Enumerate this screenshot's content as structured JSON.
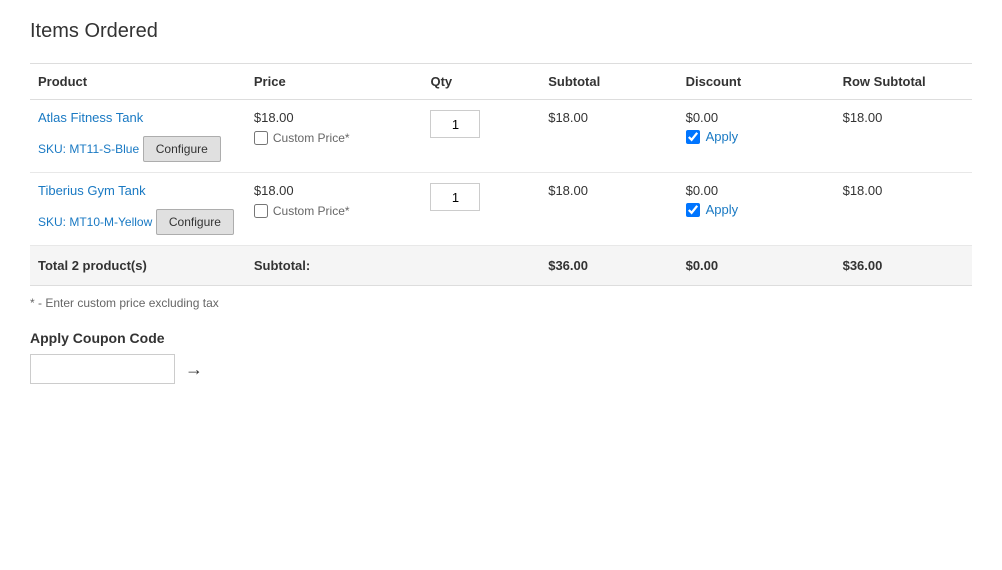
{
  "page": {
    "title": "Items Ordered"
  },
  "table": {
    "columns": [
      "Product",
      "Price",
      "Qty",
      "Subtotal",
      "Discount",
      "Row Subtotal"
    ],
    "rows": [
      {
        "product_name": "Atlas Fitness Tank",
        "sku": "SKU: MT11-S-Blue",
        "price": "$18.00",
        "custom_price_label": "Custom Price*",
        "qty": "1",
        "subtotal": "$18.00",
        "discount": "$0.00",
        "apply_checked": true,
        "apply_label": "Apply",
        "row_subtotal": "$18.00",
        "configure_label": "Configure"
      },
      {
        "product_name": "Tiberius Gym Tank",
        "sku": "SKU: MT10-M-Yellow",
        "price": "$18.00",
        "custom_price_label": "Custom Price*",
        "qty": "1",
        "subtotal": "$18.00",
        "discount": "$0.00",
        "apply_checked": true,
        "apply_label": "Apply",
        "row_subtotal": "$18.00",
        "configure_label": "Configure"
      }
    ],
    "footer": {
      "total_label": "Total 2 product(s)",
      "subtotal_label": "Subtotal:",
      "subtotal_value": "$36.00",
      "discount_value": "$0.00",
      "row_subtotal_value": "$36.00"
    }
  },
  "footnote": "* - Enter custom price excluding tax",
  "coupon": {
    "label": "Apply Coupon Code",
    "placeholder": "",
    "arrow": "→"
  }
}
